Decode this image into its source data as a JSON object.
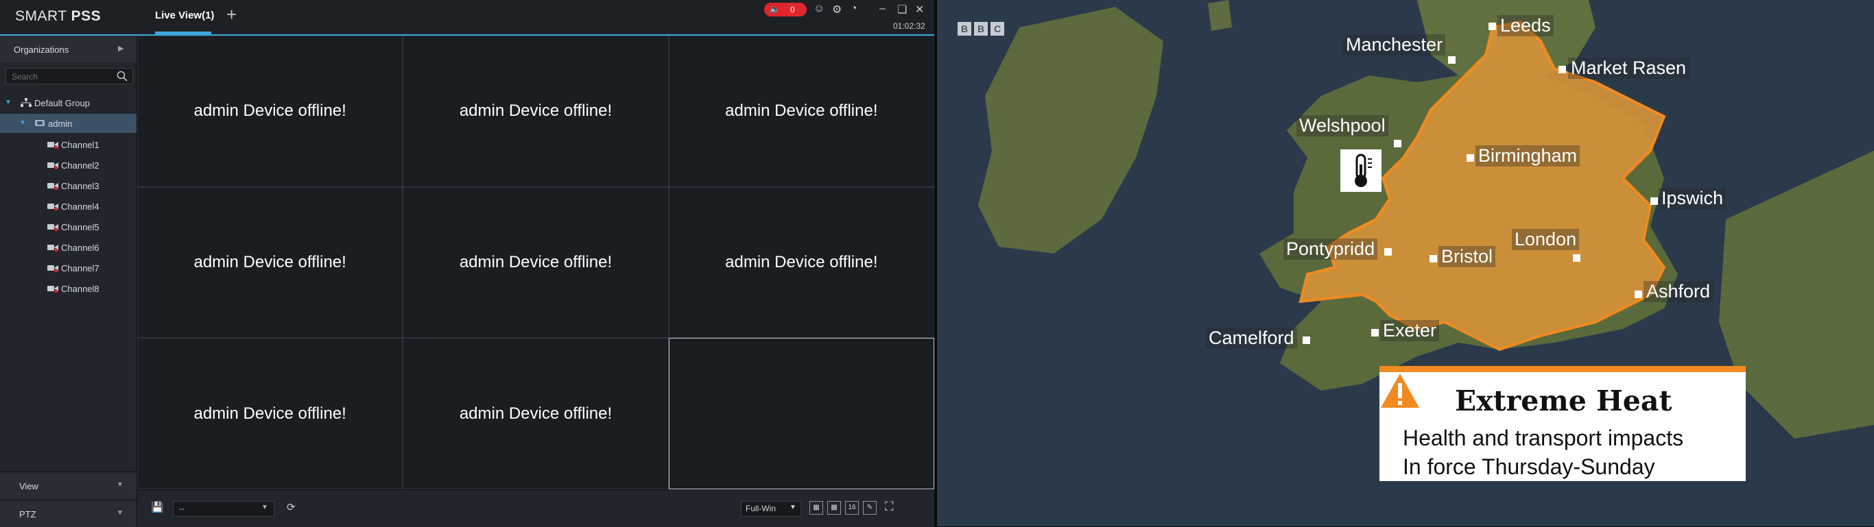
{
  "app": {
    "logo_light": "SMART ",
    "logo_bold": "PSS",
    "tab_label": "Live View(1)",
    "add_tab": "+",
    "alarm_count": "0",
    "clock": "01:02:32",
    "colors": {
      "accent": "#3aa6dd",
      "alarm": "#e0262d",
      "cell_bg": "#1a1d21"
    }
  },
  "sidebar": {
    "organizations_label": "Organizations",
    "search_placeholder": "Search",
    "group_label": "Default Group",
    "device_label": "admin",
    "channels": [
      "Channel1",
      "Channel2",
      "Channel3",
      "Channel4",
      "Channel5",
      "Channel6",
      "Channel7",
      "Channel8"
    ],
    "view_label": "View",
    "ptz_label": "PTZ"
  },
  "grid": {
    "cells": [
      "admin Device offline!",
      "admin Device offline!",
      "admin Device offline!",
      "admin Device offline!",
      "admin Device offline!",
      "admin Device offline!",
      "admin Device offline!",
      "admin Device offline!",
      ""
    ]
  },
  "bottombar": {
    "view_select": "--",
    "window_mode": "Full-Win",
    "layout_16_label": "16"
  },
  "map": {
    "broadcaster_letters": [
      "B",
      "B",
      "C"
    ],
    "places": {
      "leeds": "Leeds",
      "manchester": "Manchester",
      "market_rasen": "Market Rasen",
      "welshpool": "Welshpool",
      "birmingham": "Birmingham",
      "ipswich": "Ipswich",
      "london": "London",
      "pontypridd": "Pontypridd",
      "bristol": "Bristol",
      "ashford": "Ashford",
      "camelford": "Camelford",
      "exeter": "Exeter"
    },
    "warning": {
      "title": "Extreme Heat",
      "line1": "Health and transport impacts",
      "line2": "In force Thursday-Sunday",
      "color": "#f18a21"
    }
  }
}
